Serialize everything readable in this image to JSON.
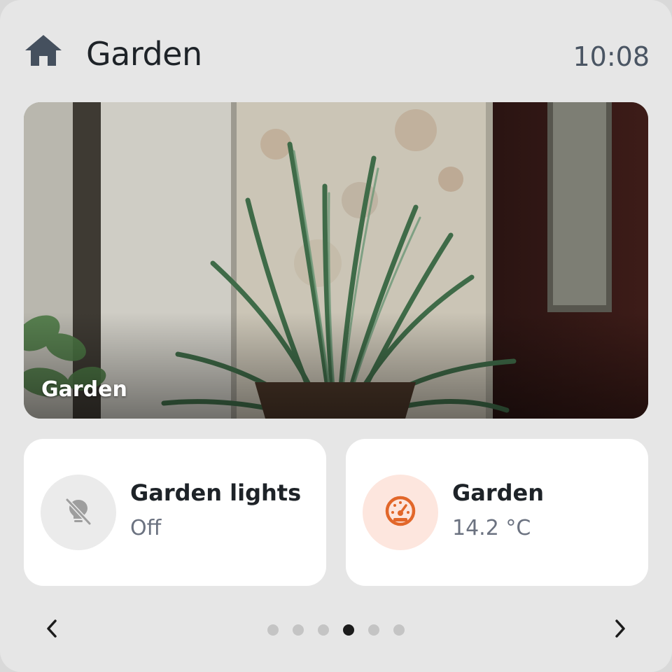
{
  "header": {
    "icon": "home-icon",
    "title": "Garden",
    "time": "10:08"
  },
  "camera": {
    "label": "Garden"
  },
  "tiles": [
    {
      "name": "Garden lights",
      "state": "Off",
      "icon": "lightbulb-off-icon",
      "icon_color": "#9e9e9e",
      "icon_bg": "#ebebeb"
    },
    {
      "name": "Garden",
      "state": "14.2 °C",
      "icon": "gauge-icon",
      "icon_color": "#e2672a",
      "icon_bg": "#fde6de"
    }
  ],
  "pager": {
    "prev": "‹",
    "next": "›",
    "total_pages": 6,
    "active_page": 4
  }
}
